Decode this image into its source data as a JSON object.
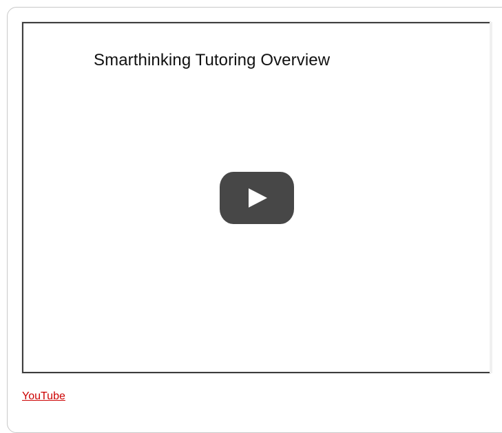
{
  "video": {
    "title": "Smarthinking Tutoring Overview",
    "play_icon": "play-icon"
  },
  "link": {
    "label": "YouTube"
  },
  "colors": {
    "link": "#cc0000",
    "play_button": "#474747",
    "frame_border": "#3c3c3c",
    "card_border": "#c8c8c8"
  }
}
